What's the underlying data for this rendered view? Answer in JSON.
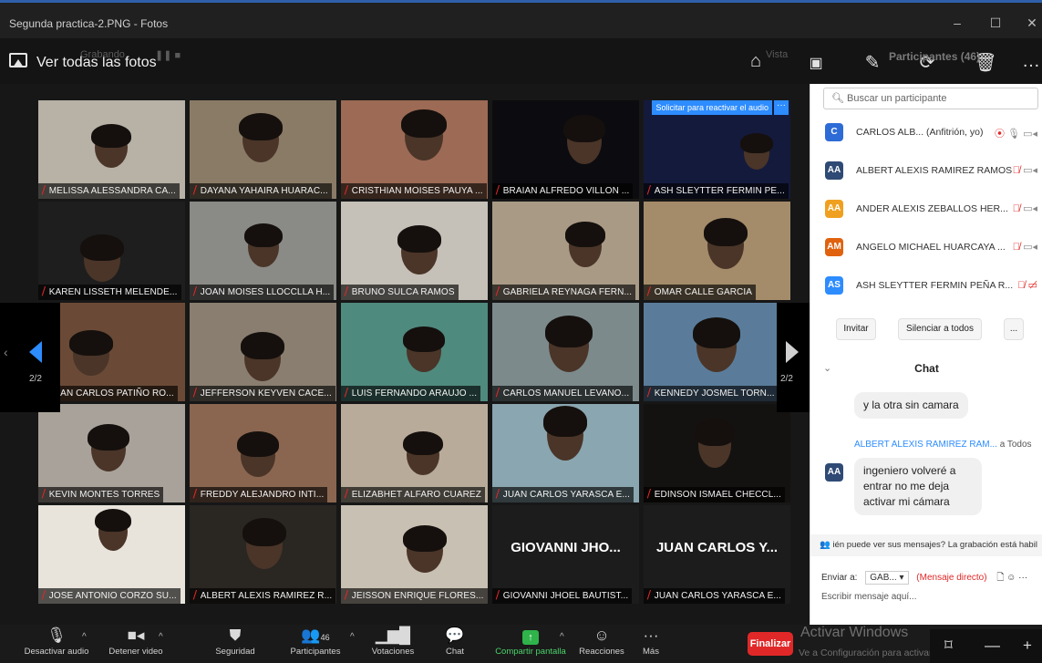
{
  "window": {
    "title": "Segunda practica-2.PNG - Fotos",
    "minimize": "–",
    "maximize": "☐",
    "close": "✕"
  },
  "photos_bar": {
    "view_all": "Ver todas las fotos",
    "faint_left": "Grabando",
    "faint_view": "Vista",
    "participants_header": "Participantes (46)"
  },
  "grid": {
    "tiles": [
      {
        "name": "MELISSA ALESSANDRA CA...",
        "bg": "#b7b1a6"
      },
      {
        "name": "DAYANA YAHAIRA HUARAC...",
        "bg": "#8a7b66"
      },
      {
        "name": "CRISTHIAN MOISES PAUYA ...",
        "bg": "#9c6a55"
      },
      {
        "name": "BRAIAN ALFREDO VILLON ...",
        "bg": "#0c0c10"
      },
      {
        "name": "ASH SLEYTTER FERMIN PE...",
        "bg": "#141a3c",
        "reactivate": "Solicitar para reactivar el audio",
        "more": "···"
      },
      {
        "name": "KAREN LISSETH MELENDE...",
        "bg": "#1e1e1e"
      },
      {
        "name": "JOAN MOISES LLOCCLLA H...",
        "bg": "#8a8a86"
      },
      {
        "name": "BRUNO SULCA RAMOS",
        "bg": "#c5c0b8"
      },
      {
        "name": "GABRIELA REYNAGA FERN...",
        "bg": "#a99a86"
      },
      {
        "name": "OMAR CALLE GARCIA",
        "bg": "#a48c6a"
      },
      {
        "name": "JUAN CARLOS PATIÑO RO...",
        "bg": "#6a4a36"
      },
      {
        "name": "JEFFERSON KEYVEN CACE...",
        "bg": "#8a7e70"
      },
      {
        "name": "LUIS FERNANDO ARAUJO ...",
        "bg": "#4f8a7e"
      },
      {
        "name": "CARLOS MANUEL LEVANO...",
        "bg": "#7c8a8c"
      },
      {
        "name": "KENNEDY JOSMEL TORN...",
        "bg": "#5a7c9a"
      },
      {
        "name": "KEVIN MONTES TORRES",
        "bg": "#a8a29a"
      },
      {
        "name": "FREDDY ALEJANDRO INTI...",
        "bg": "#8a6650"
      },
      {
        "name": "ELIZABHET ALFARO CUAREZ",
        "bg": "#b8ab9a"
      },
      {
        "name": "JUAN CARLOS YARASCA E...",
        "bg": "#8aa6b0"
      },
      {
        "name": "EDINSON ISMAEL CHECCL...",
        "bg": "#141210"
      },
      {
        "name": "JOSE ANTONIO CORZO SU...",
        "bg": "#e8e4dc"
      },
      {
        "name": "ALBERT ALEXIS RAMIREZ R...",
        "bg": "#2a2622"
      },
      {
        "name": "JEISSON ENRIQUE FLORES...",
        "bg": "#c8c0b2"
      },
      {
        "name": "GIOVANNI JHOEL BAUTIST...",
        "bg": "#1c1c1c",
        "big": "GIOVANNI JHO..."
      },
      {
        "name": "JUAN CARLOS YARASCA E...",
        "bg": "#1c1c1c",
        "big": "JUAN CARLOS Y..."
      }
    ],
    "page_left": "2/2",
    "page_right": "2/2"
  },
  "toolbar": {
    "mute": "Desactivar audio",
    "video": "Detener video",
    "security": "Seguridad",
    "participants": "Participantes",
    "participants_count": "46",
    "polls": "Votaciones",
    "chat": "Chat",
    "share": "Compartir pantalla",
    "reactions": "Reacciones",
    "more": "Más",
    "end": "Finalizar"
  },
  "panel": {
    "search_placeholder": "Buscar un participante",
    "participants": [
      {
        "initials": "C",
        "color": "#2d6bd6",
        "name": "CARLOS ALB...  (Anfitrión, yo)"
      },
      {
        "initials": "AA",
        "color": "#2f4a75",
        "name": "ALBERT ALEXIS RAMIREZ RAMOS"
      },
      {
        "initials": "AA",
        "color": "#f0a020",
        "name": "ANDER ALEXIS ZEBALLOS HER..."
      },
      {
        "initials": "AM",
        "color": "#e0620e",
        "name": "ANGELO MICHAEL HUARCAYA ..."
      },
      {
        "initials": "AS",
        "color": "#2d8cff",
        "name": "ASH SLEYTTER FERMIN PEÑA R..."
      }
    ],
    "invite": "Invitar",
    "mute_all": "Silenciar a todos",
    "more": "...",
    "chat_title": "Chat",
    "msg1": "y la otra sin camara",
    "sender_name": "ALBERT ALEXIS RAMIREZ RAM...",
    "sender_to": "a Todos",
    "sender_initials": "AA",
    "msg2": "ingeniero volveré a entrar no me deja activar mi cámara",
    "notice": "ién puede ver sus mensajes? La grabación está habil",
    "send_to_label": "Enviar a:",
    "send_to_value": "GAB...",
    "direct": "(Mensaje directo)",
    "compose_placeholder": "Escribir mensaje aquí..."
  },
  "watermark": {
    "line1": "Activar Windows",
    "line2": "Ve a Configuración para activar Windows."
  }
}
